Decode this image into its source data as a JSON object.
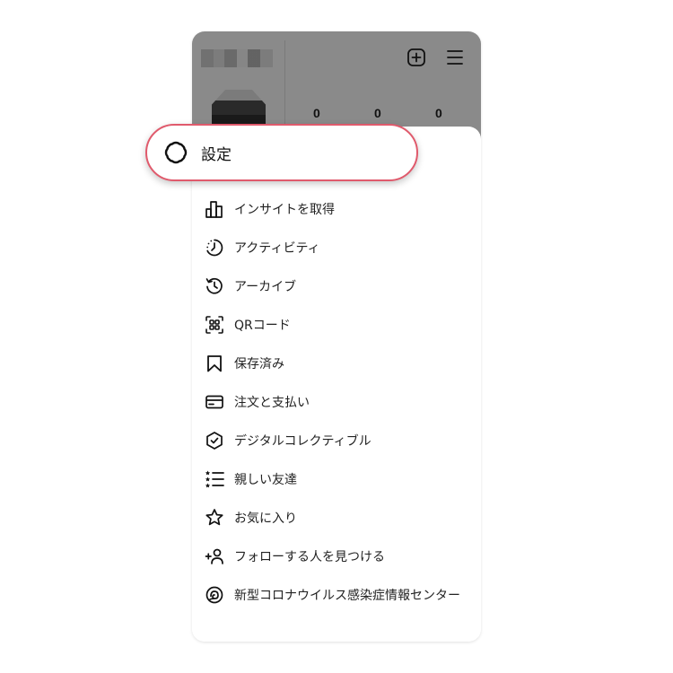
{
  "header": {
    "stats": [
      "0",
      "0",
      "0"
    ],
    "plus_icon": "add-square-icon",
    "menu_icon": "hamburger-menu-icon"
  },
  "highlight": {
    "color": "#e05a6c"
  },
  "settings": {
    "label": "設定",
    "icon": "gear-icon"
  },
  "menu": {
    "items": [
      {
        "label": "インサイトを取得",
        "icon": "insights-bar-chart-icon"
      },
      {
        "label": "アクティビティ",
        "icon": "activity-clock-icon"
      },
      {
        "label": "アーカイブ",
        "icon": "archive-history-icon"
      },
      {
        "label": "QRコード",
        "icon": "qr-code-icon"
      },
      {
        "label": "保存済み",
        "icon": "bookmark-icon"
      },
      {
        "label": "注文と支払い",
        "icon": "credit-card-icon"
      },
      {
        "label": "デジタルコレクティブル",
        "icon": "verified-badge-icon"
      },
      {
        "label": "親しい友達",
        "icon": "close-friends-list-icon"
      },
      {
        "label": "お気に入り",
        "icon": "star-icon"
      },
      {
        "label": "フォローする人を見つける",
        "icon": "add-person-icon"
      },
      {
        "label": "新型コロナウイルス感染症情報センター",
        "icon": "covid-info-icon"
      }
    ]
  }
}
